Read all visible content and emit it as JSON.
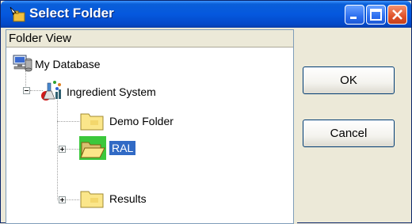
{
  "window": {
    "title": "Select Folder",
    "title_icon": "select-folder-icon",
    "controls": [
      "minimize-icon",
      "maximize-icon",
      "close-icon"
    ]
  },
  "panel": {
    "header": "Folder View"
  },
  "tree": {
    "root": {
      "label": "My Database",
      "icon": "database-server-icon"
    },
    "system": {
      "label": "Ingredient System",
      "icon": "ingredient-system-icon",
      "expanded": true
    },
    "children": [
      {
        "label": "Demo Folder",
        "icon": "folder-icon",
        "expandable": false,
        "selected": false
      },
      {
        "label": "RAL",
        "icon": "open-folder-icon",
        "expandable": true,
        "selected": true
      },
      {
        "label": "Results",
        "icon": "folder-icon",
        "expandable": true,
        "selected": false
      }
    ]
  },
  "buttons": {
    "ok": "OK",
    "cancel": "Cancel"
  },
  "colors": {
    "title_bar": "#0558de",
    "selection": "#316ac5",
    "close_button": "#e0522a"
  }
}
